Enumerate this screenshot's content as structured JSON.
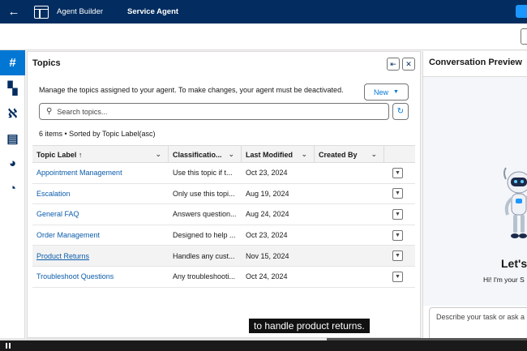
{
  "header": {
    "app_name": "Agent Builder",
    "agent_name": "Service Agent"
  },
  "rail": {
    "items": [
      {
        "icon": "hash-icon",
        "glyph": "#",
        "active": true
      },
      {
        "icon": "components-icon",
        "glyph": "▚",
        "active": false
      },
      {
        "icon": "actions-icon",
        "glyph": "ℵ",
        "active": false
      },
      {
        "icon": "library-icon",
        "glyph": "▤",
        "active": false
      },
      {
        "icon": "palette-icon",
        "glyph": "◕",
        "active": false
      },
      {
        "icon": "analytics-icon",
        "glyph": "◔",
        "active": false
      }
    ]
  },
  "topics": {
    "title": "Topics",
    "description": "Manage the topics assigned to your agent. To make changes, your agent must be deactivated.",
    "new_label": "New",
    "search_placeholder": "Search topics...",
    "items_info": "6 items • Sorted by Topic Label(asc)",
    "columns": [
      "Topic Label ↑",
      "Classificatio...",
      "Last Modified",
      "Created By"
    ],
    "rows": [
      {
        "label": "Appointment Management",
        "classification": "Use this topic if t...",
        "modified": "Oct 23, 2024",
        "created_by": ""
      },
      {
        "label": "Escalation",
        "classification": "Only use this topi...",
        "modified": "Aug 19, 2024",
        "created_by": ""
      },
      {
        "label": "General FAQ",
        "classification": "Answers question...",
        "modified": "Aug 24, 2024",
        "created_by": ""
      },
      {
        "label": "Order Management",
        "classification": "Designed to help ...",
        "modified": "Oct 23, 2024",
        "created_by": ""
      },
      {
        "label": "Product Returns",
        "classification": "Handles any cust...",
        "modified": "Nov 15, 2024",
        "created_by": ""
      },
      {
        "label": "Troubleshoot Questions",
        "classification": "Any troubleshooti...",
        "modified": "Oct 24, 2024",
        "created_by": ""
      }
    ]
  },
  "preview": {
    "title": "Conversation Preview",
    "lets_text": "Let's",
    "greeting": "Hi! I'm your S",
    "input_placeholder": "Describe your task or ask a"
  },
  "caption": "to handle product returns.",
  "video": {
    "progress": 0.62
  },
  "colors": {
    "header_bg": "#032d60",
    "accent": "#0176d3",
    "link": "#0b5cab"
  }
}
